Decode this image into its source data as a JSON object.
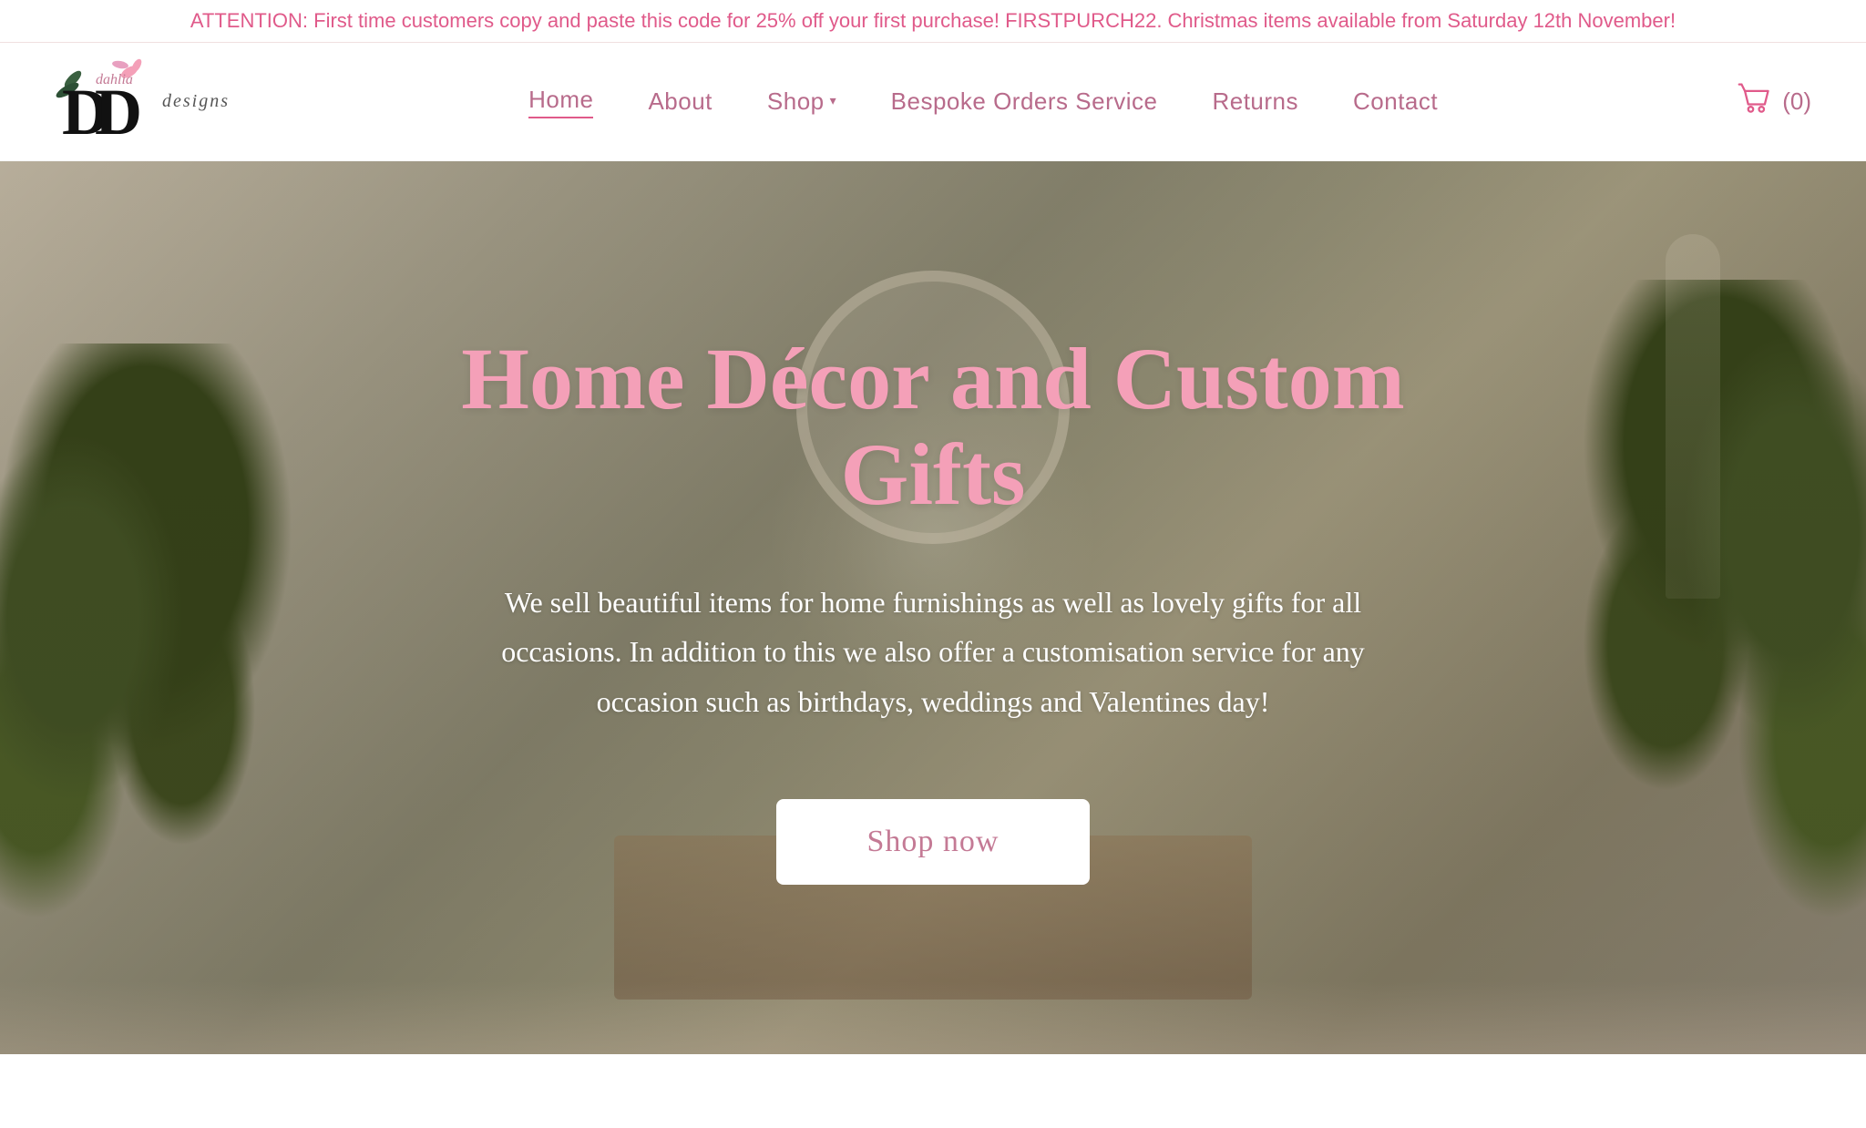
{
  "announcement": {
    "text": "ATTENTION: First time customers copy and paste this code for 25% off your first purchase! FIRSTPURCH22. Christmas items available from Saturday 12th November!"
  },
  "header": {
    "logo": {
      "brand_name": "dahlia",
      "sub_name": "designs",
      "big_letter": "DD"
    },
    "nav": {
      "items": [
        {
          "label": "Home",
          "active": true
        },
        {
          "label": "About",
          "active": false
        },
        {
          "label": "Shop",
          "active": false,
          "has_dropdown": true
        },
        {
          "label": "Bespoke Orders Service",
          "active": false
        },
        {
          "label": "Returns",
          "active": false
        },
        {
          "label": "Contact",
          "active": false
        }
      ]
    },
    "cart": {
      "count_label": "(0)"
    }
  },
  "hero": {
    "title": "Home Décor and Custom Gifts",
    "description": "We sell beautiful items for home furnishings as well as lovely gifts for all occasions. In addition to this we also offer a customisation service for any occasion such as birthdays, weddings and Valentines day!",
    "cta_label": "Shop now"
  }
}
